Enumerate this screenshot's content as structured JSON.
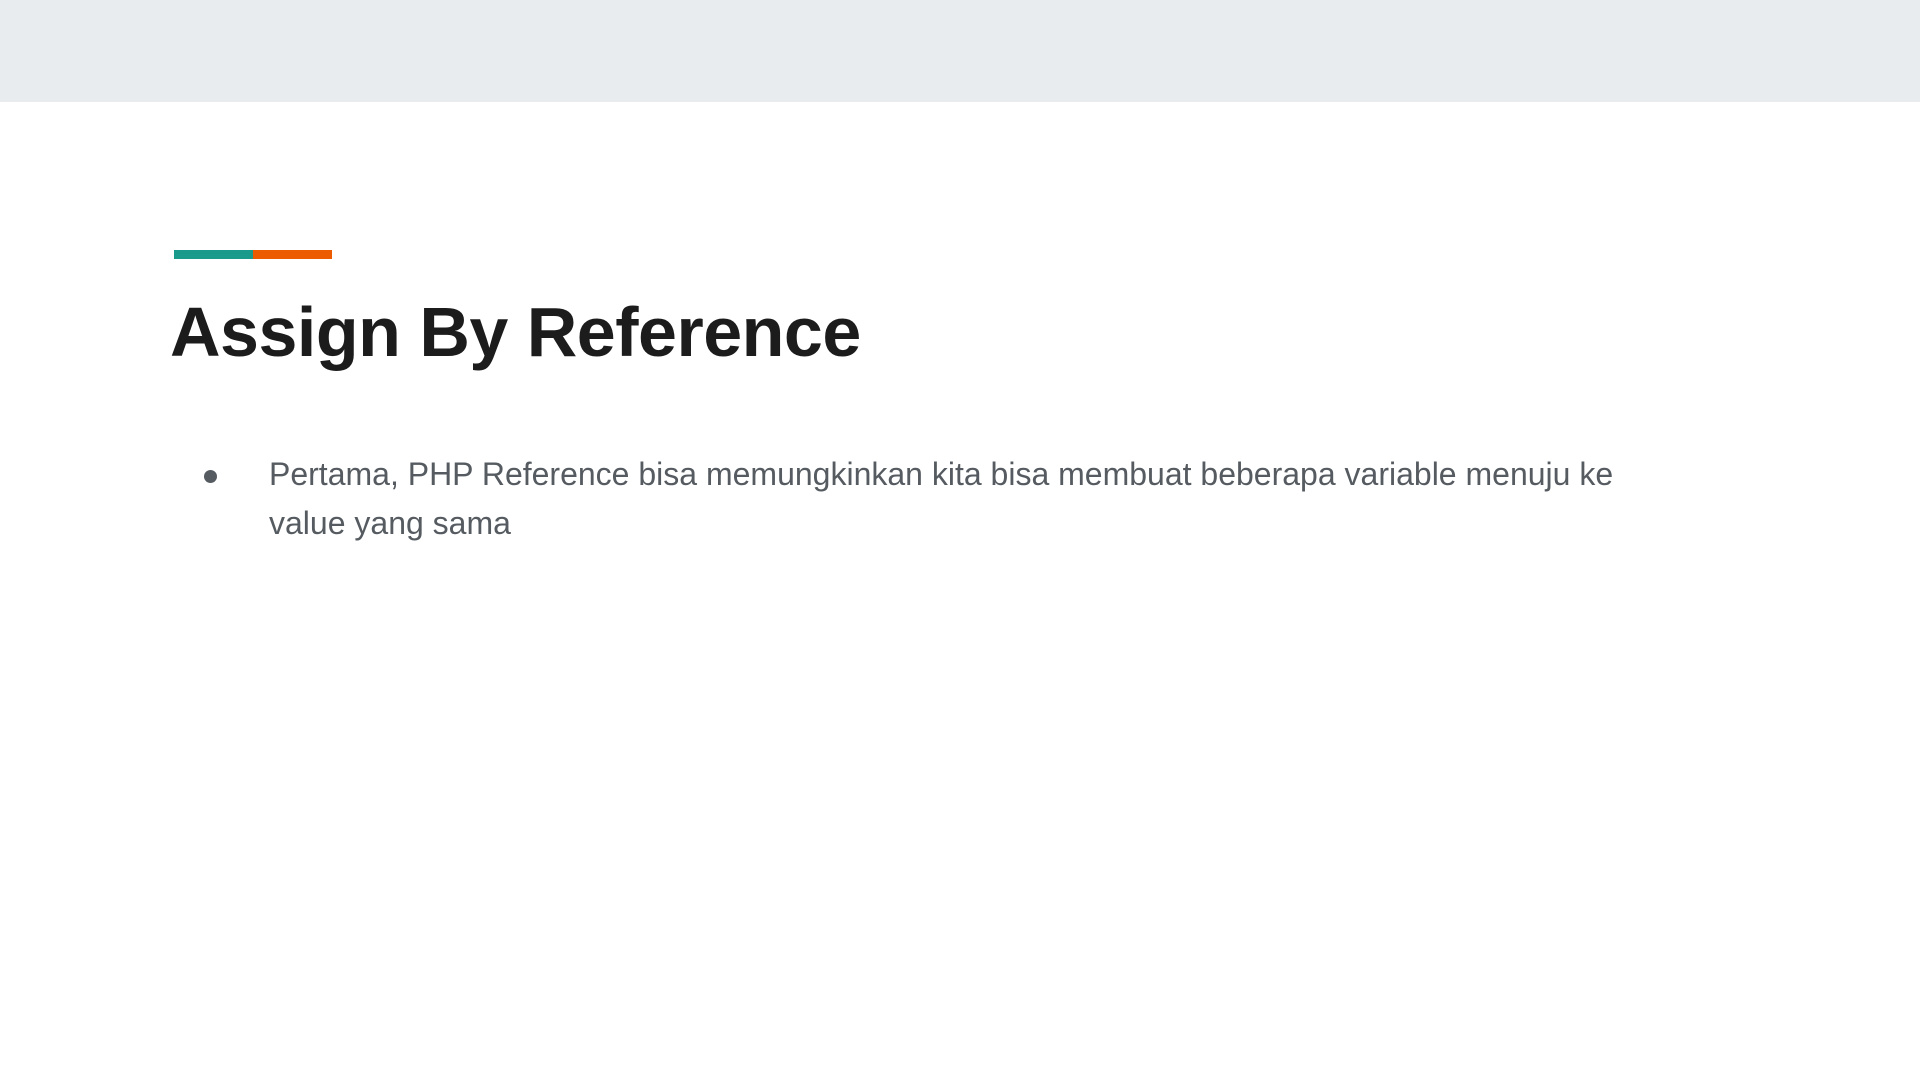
{
  "colors": {
    "top_band": "#e8ecee",
    "accent_left": "#1a9a8a",
    "accent_right": "#ec5b00"
  },
  "slide": {
    "title": "Assign By Reference",
    "bullets": [
      "Pertama, PHP Reference bisa memungkinkan kita bisa membuat beberapa variable menuju ke value yang sama"
    ]
  }
}
